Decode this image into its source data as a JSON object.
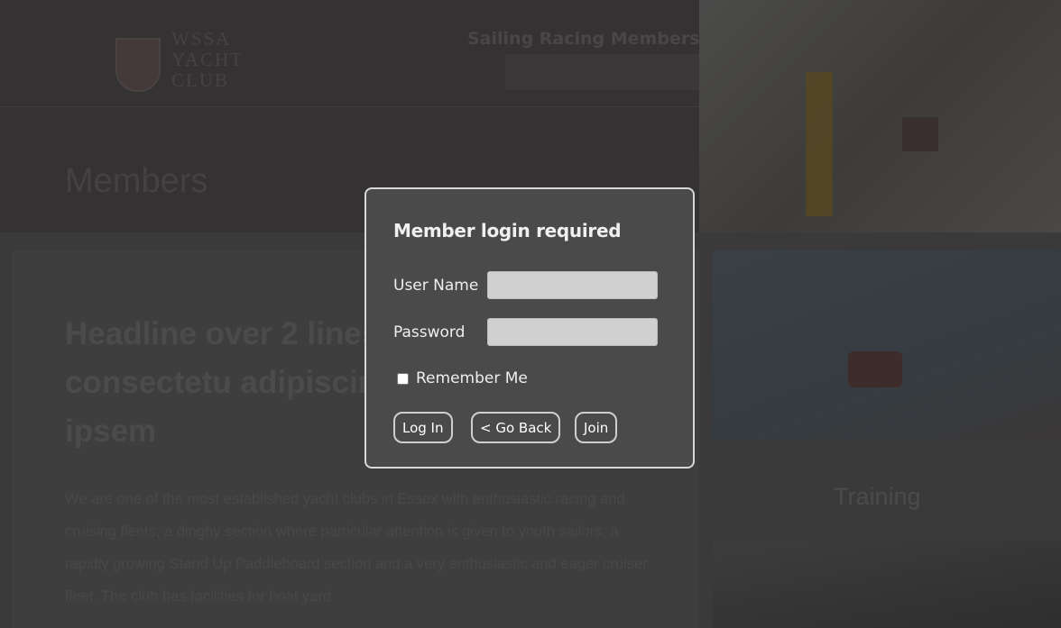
{
  "background": {
    "logo": {
      "line1": "WSSA",
      "line2": "YACHT",
      "line3": "CLUB"
    },
    "nav": "Sailing  Racing  Members",
    "page_title": "Members",
    "headline": "Headline over 2 lines sit amet, consectetu adipiscing elit 2 lines lorem ipsem",
    "body": "We are one of the most established yacht clubs in Essex with enthusiastic racing and cruising fleets, a dinghy section where particular attention is given to youth sailors, a rapidly growing Stand Up Paddleboard section and a very enthusiastic and eager cruiser fleet. The club has facilities for boat yard",
    "side_label": "Training"
  },
  "modal": {
    "title": "Member login required",
    "username": {
      "label": "User Name",
      "value": "",
      "placeholder": ""
    },
    "password": {
      "label": "Password",
      "value": "",
      "placeholder": ""
    },
    "remember": {
      "label": "Remember Me",
      "checked": false
    },
    "buttons": {
      "login": "Log In",
      "back": "< Go Back",
      "join": "Join"
    }
  },
  "colors": {
    "overlay": "#3b3a3a",
    "modal_bg": "#4a4a4a",
    "modal_border": "#d8d8d8",
    "input_bg": "#d0d0d0",
    "text": "#f0f0f0"
  }
}
